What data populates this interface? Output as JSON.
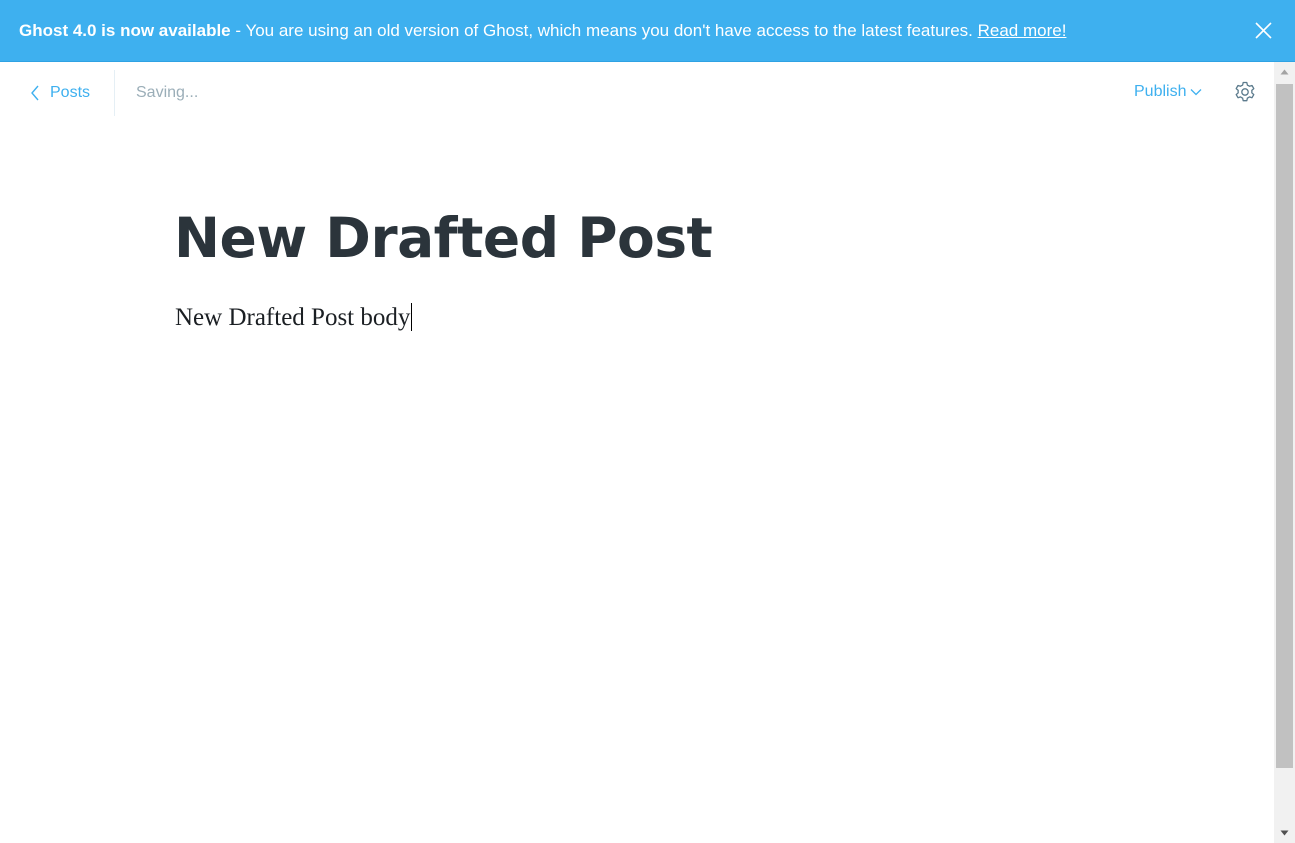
{
  "banner": {
    "headline": "Ghost 4.0 is now available",
    "message": " - You are using an old version of Ghost, which means you don't have access to the latest features. ",
    "link_text": "Read more!",
    "close_icon": "close-icon"
  },
  "header": {
    "back_label": "Posts",
    "back_icon": "chevron-left-icon",
    "status": "Saving...",
    "publish_label": "Publish",
    "publish_icon": "chevron-down-icon",
    "settings_icon": "gear-icon"
  },
  "post": {
    "title": "New Drafted Post",
    "body": "New Drafted Post body"
  },
  "colors": {
    "accent": "#3eb0ef",
    "title": "#2b343b",
    "status": "#9baeb8"
  }
}
